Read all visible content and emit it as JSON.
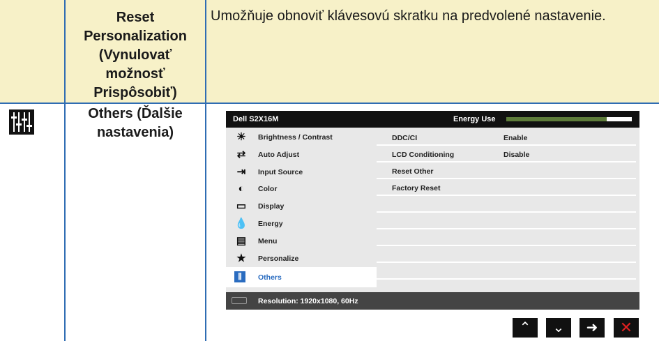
{
  "rows": [
    {
      "setting": "Reset Personalization (Vynulovať možnosť Prispôsobiť)",
      "setting_lines": [
        "Reset",
        "Personalization",
        "(Vynulovať",
        "možnosť",
        "Prispôsobiť)"
      ],
      "description": "Umožňuje obnoviť klávesovú skratku na predvolené nastavenie."
    },
    {
      "icon": "others-icon",
      "setting_lines": [
        "Others (Ďalšie",
        "nastavenia)"
      ]
    }
  ],
  "osd": {
    "model": "Dell S2X16M",
    "energy_label": "Energy Use",
    "energy_level": 0.8,
    "menu": [
      {
        "label": "Brightness / Contrast",
        "icon": "brightness-icon"
      },
      {
        "label": "Auto Adjust",
        "icon": "auto-adjust-icon"
      },
      {
        "label": "Input Source",
        "icon": "input-source-icon"
      },
      {
        "label": "Color",
        "icon": "color-icon"
      },
      {
        "label": "Display",
        "icon": "display-icon"
      },
      {
        "label": "Energy",
        "icon": "energy-icon"
      },
      {
        "label": "Menu",
        "icon": "menu-icon"
      },
      {
        "label": "Personalize",
        "icon": "star-icon"
      },
      {
        "label": "Others",
        "icon": "others-icon",
        "selected": true
      }
    ],
    "submenu": [
      {
        "label": "DDC/CI",
        "value": "Enable"
      },
      {
        "label": "LCD Conditioning",
        "value": "Disable"
      },
      {
        "label": "Reset Other",
        "value": ""
      },
      {
        "label": "Factory Reset",
        "value": ""
      }
    ],
    "resolution": "Resolution: 1920x1080, 60Hz",
    "nav": [
      "up-arrow-icon",
      "down-arrow-icon",
      "right-arrow-icon",
      "close-icon"
    ]
  },
  "colors": {
    "table_border": "#2f6db3",
    "row_highlight": "#f7f1c8",
    "osd_selected": "#2a6cc0",
    "energy_fill": "#5e7c3a",
    "close": "#e02020"
  }
}
